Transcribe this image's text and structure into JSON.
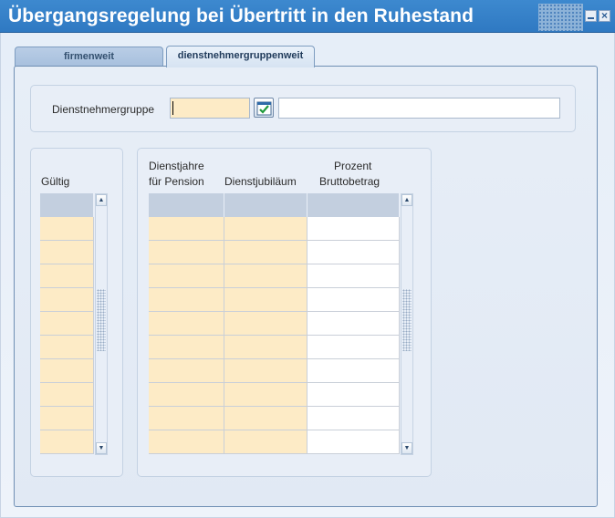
{
  "window": {
    "title": "Übergangsregelung bei Übertritt in den Ruhestand",
    "minimize_glyph": "",
    "close_glyph": "×"
  },
  "tabs": [
    {
      "label": "firmenweit",
      "active": false
    },
    {
      "label": "dienstnehmergruppenweit",
      "active": true
    }
  ],
  "form": {
    "dienstnehmergruppe_label": "Dienstnehmergruppe",
    "dienstnehmergruppe_value": "",
    "dienstnehmergruppe_description": "",
    "lov_icon": "calendar-check-icon"
  },
  "gueltig_block": {
    "header": "Gültig",
    "rows": [
      "",
      "",
      "",
      "",
      "",
      "",
      "",
      "",
      "",
      ""
    ]
  },
  "pension_block": {
    "headers": {
      "col1_line1": "Dienstjahre",
      "col1_line2": "für Pension",
      "col2": "Dienstjubiläum",
      "col3_line1": "Prozent",
      "col3_line2": "Bruttobetrag"
    },
    "rows": [
      [
        "",
        "",
        ""
      ],
      [
        "",
        "",
        ""
      ],
      [
        "",
        "",
        ""
      ],
      [
        "",
        "",
        ""
      ],
      [
        "",
        "",
        ""
      ],
      [
        "",
        "",
        ""
      ],
      [
        "",
        "",
        ""
      ],
      [
        "",
        "",
        ""
      ],
      [
        "",
        "",
        ""
      ],
      [
        "",
        "",
        ""
      ]
    ]
  },
  "scrollbar": {
    "up_glyph": "▲",
    "down_glyph": "▼"
  },
  "colors": {
    "titlebar": "#3380c8",
    "required_field": "#fdebc6",
    "panel": "#e6eef8"
  }
}
